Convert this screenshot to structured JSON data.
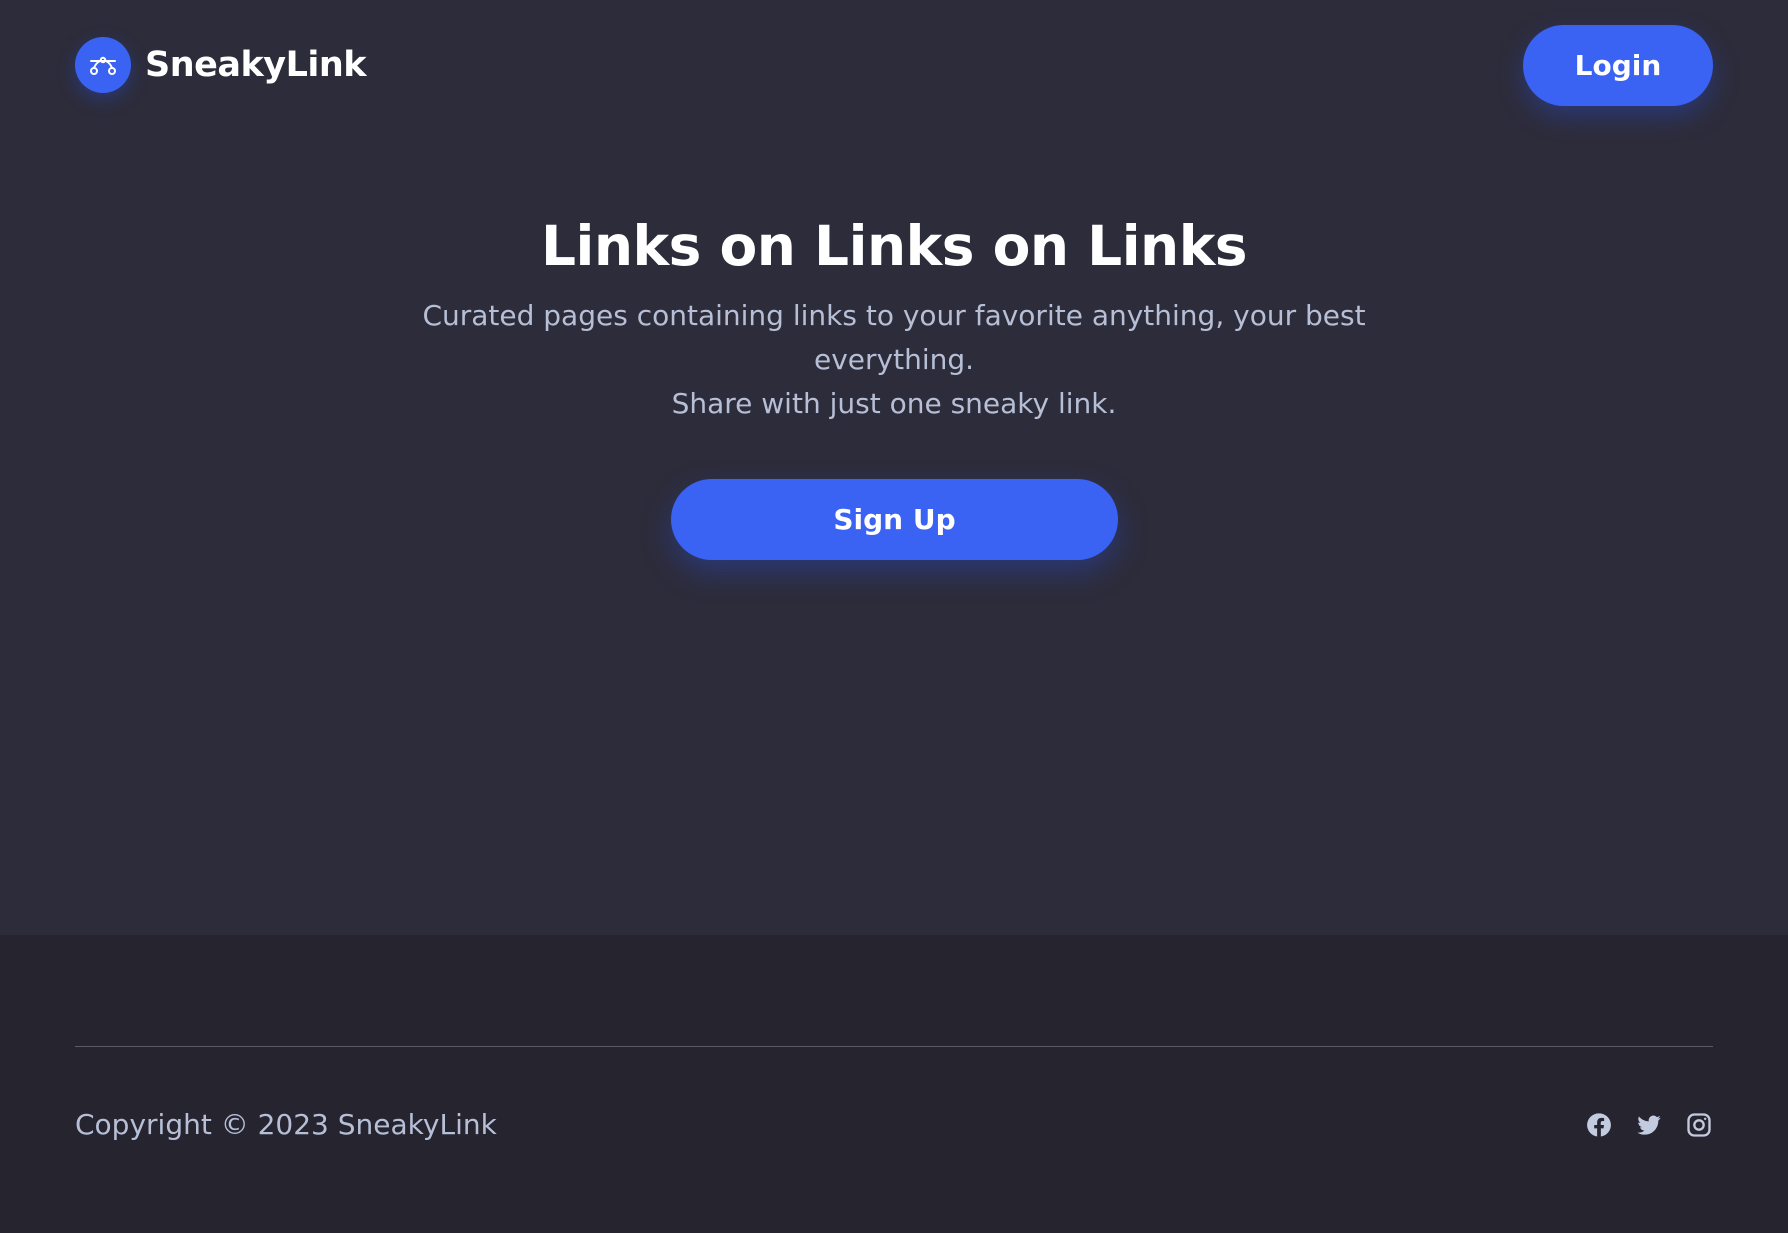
{
  "header": {
    "brand_name": "SneakyLink",
    "login_label": "Login"
  },
  "hero": {
    "title": "Links on Links on Links",
    "subtitle_line1": "Curated pages containing links to your favorite anything, your best everything.",
    "subtitle_line2": "Share with just one sneaky link.",
    "signup_label": "Sign Up"
  },
  "footer": {
    "copyright": "Copyright © 2023 SneakyLink",
    "social_icons": [
      "facebook-icon",
      "twitter-icon",
      "instagram-icon"
    ]
  },
  "colors": {
    "background": "#2d2c3a",
    "footer_background": "#25242f",
    "accent": "#3a63f3",
    "muted_text": "#b6bfd6"
  },
  "icons": {
    "logo": "bezier-curve-icon"
  }
}
